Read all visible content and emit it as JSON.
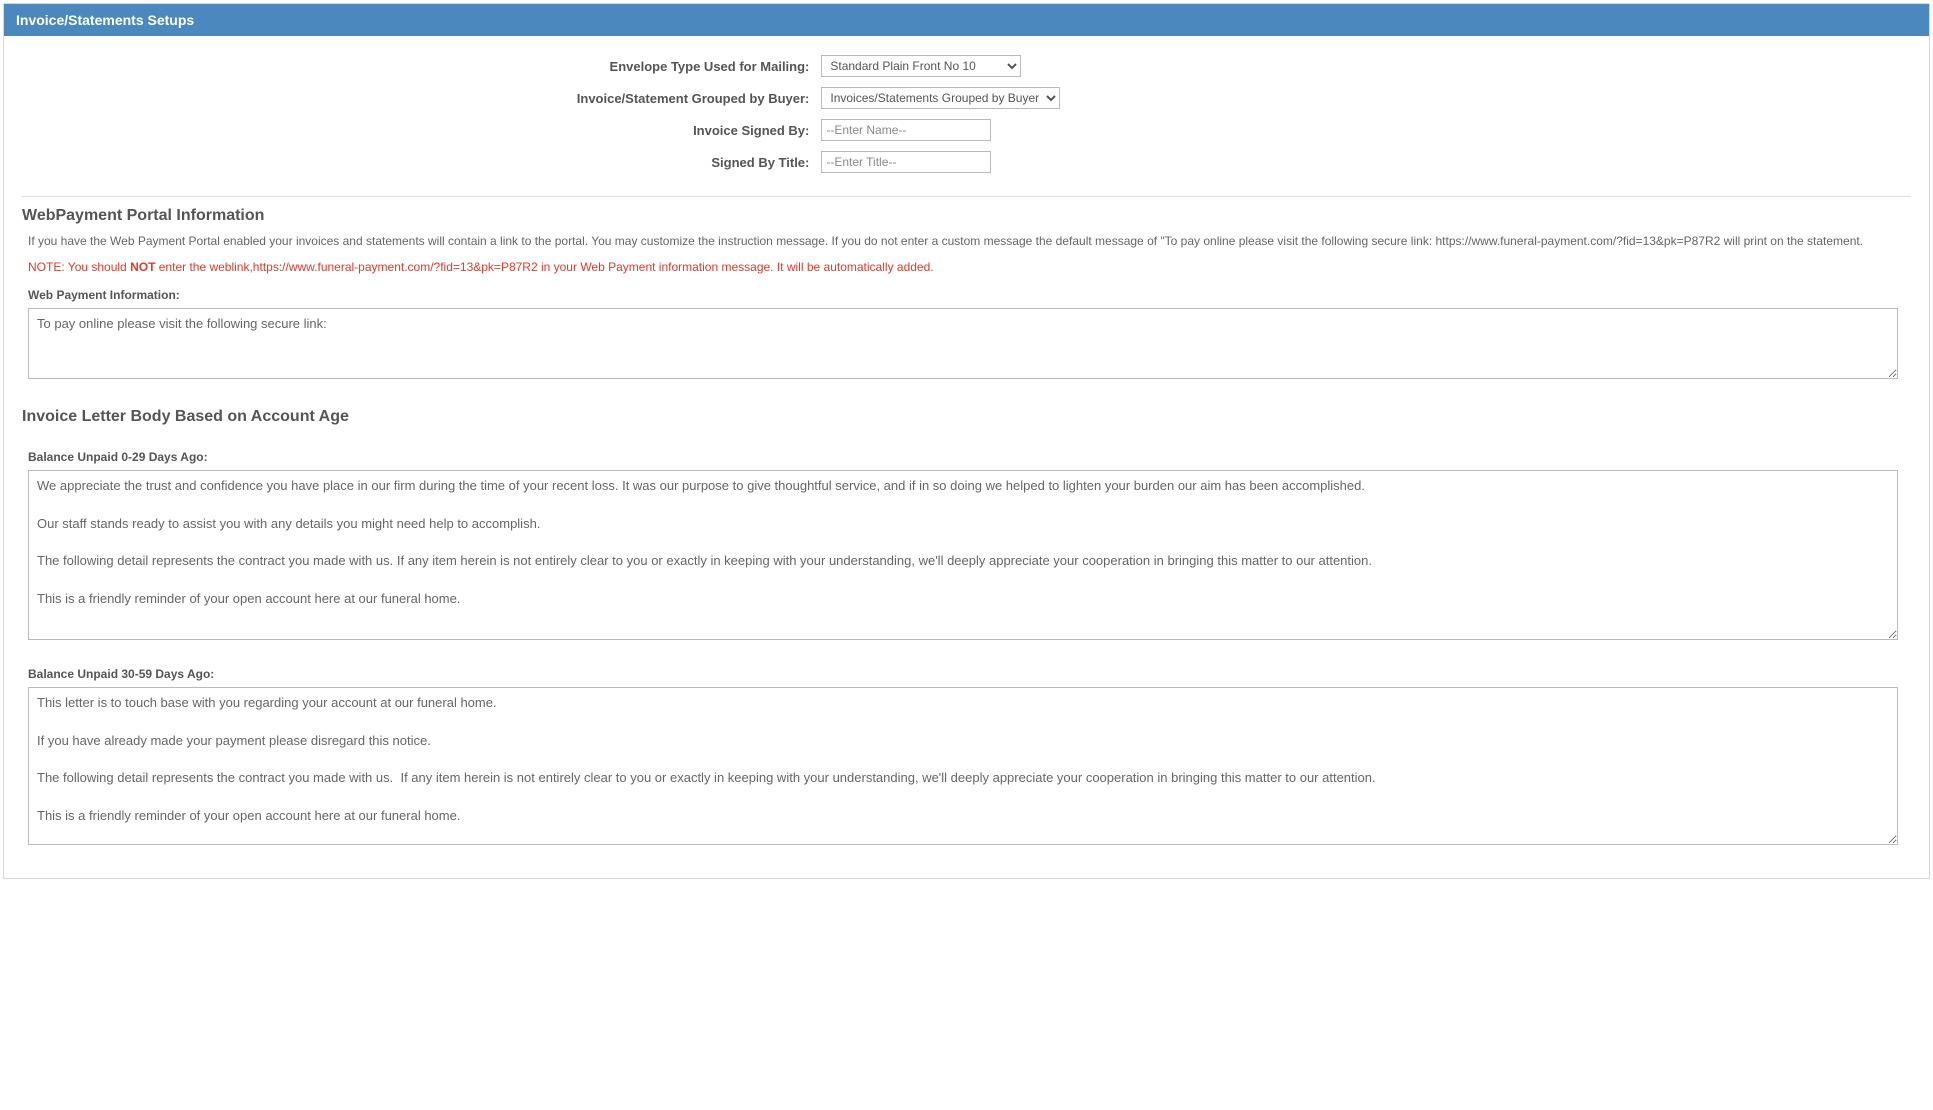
{
  "header": {
    "title": "Invoice/Statements Setups"
  },
  "form": {
    "envelope_label": "Envelope Type Used for Mailing:",
    "envelope_value": "Standard Plain Front No 10",
    "grouped_label": "Invoice/Statement Grouped by Buyer:",
    "grouped_value": "Invoices/Statements Grouped by Buyer",
    "signed_by_label": "Invoice Signed By:",
    "signed_by_placeholder": "--Enter Name--",
    "signed_title_label": "Signed By Title:",
    "signed_title_placeholder": "--Enter Title--"
  },
  "webpayment": {
    "section_title": "WebPayment Portal Information",
    "desc": "If you have the Web Payment Portal enabled your invoices and statements will contain a link to the portal. You may customize the instruction message. If you do not enter a custom message the default message of \"To pay online please visit the following secure link: https://www.funeral-payment.com/?fid=13&pk=P87R2 will print on the statement.",
    "note_prefix": "NOTE: You should ",
    "note_emph": "NOT",
    "note_suffix": " enter the weblink,https://www.funeral-payment.com/?fid=13&pk=P87R2 in your Web Payment information message. It will be automatically added.",
    "info_label": "Web Payment Information:",
    "info_value": "To pay online please visit the following secure link:"
  },
  "letterbody": {
    "section_title": "Invoice Letter Body Based on Account Age",
    "b0_29_label": "Balance Unpaid 0-29 Days Ago:",
    "b0_29_value": "We appreciate the trust and confidence you have place in our firm during the time of your recent loss. It was our purpose to give thoughtful service, and if in so doing we helped to lighten your burden our aim has been accomplished.\n\nOur staff stands ready to assist you with any details you might need help to accomplish.\n\nThe following detail represents the contract you made with us. If any item herein is not entirely clear to you or exactly in keeping with your understanding, we'll deeply appreciate your cooperation in bringing this matter to our attention.\n\nThis is a friendly reminder of your open account here at our funeral home.",
    "b30_59_label": "Balance Unpaid 30-59 Days Ago:",
    "b30_59_value": "This letter is to touch base with you regarding your account at our funeral home.\n\nIf you have already made your payment please disregard this notice.\n\nThe following detail represents the contract you made with us.  If any item herein is not entirely clear to you or exactly in keeping with your understanding, we'll deeply appreciate your cooperation in bringing this matter to our attention.\n\nThis is a friendly reminder of your open account here at our funeral home."
  }
}
